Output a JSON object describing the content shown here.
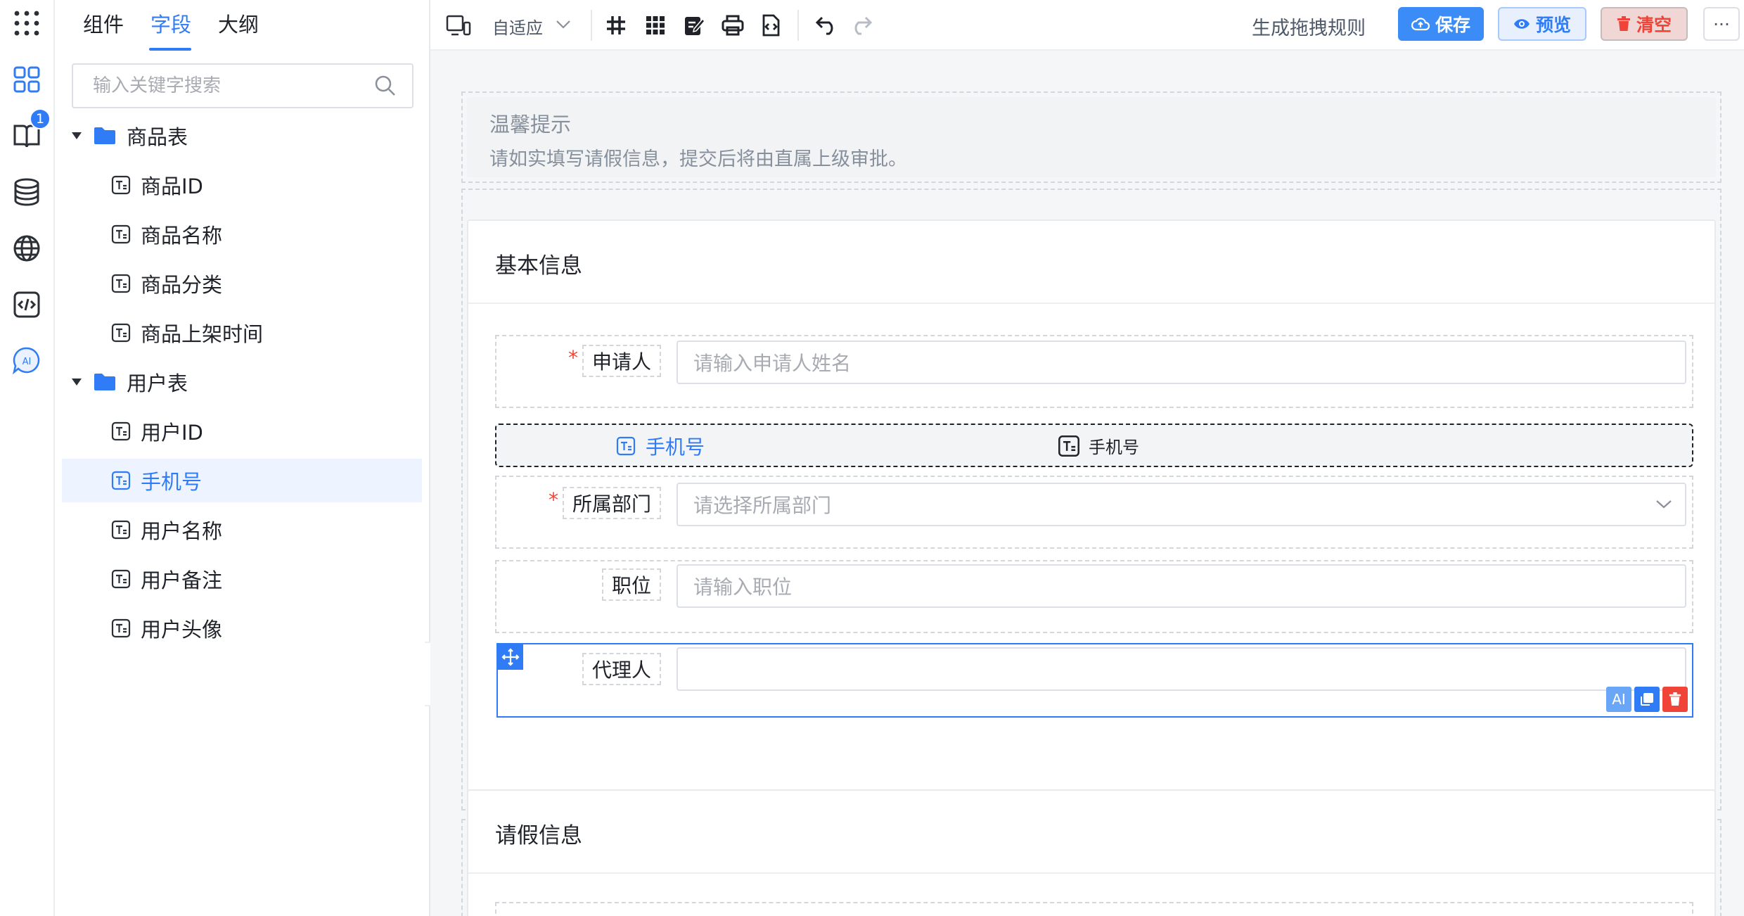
{
  "sidebar_tabs": [
    "组件",
    "字段",
    "大纲"
  ],
  "active_tab": "字段",
  "rail": {
    "badge": "1",
    "ai_label": "AI",
    "icons": [
      "component-grid-icon",
      "book-icon",
      "database-icon",
      "globe-icon",
      "code-icon",
      "ai-chat-icon"
    ]
  },
  "search": {
    "placeholder": "输入关键字搜索"
  },
  "tree": [
    {
      "name": "商品表",
      "fields": [
        "商品ID",
        "商品名称",
        "商品分类",
        "商品上架时间"
      ]
    },
    {
      "name": "用户表",
      "fields": [
        "用户ID",
        "手机号",
        "用户名称",
        "用户备注",
        "用户头像"
      ]
    }
  ],
  "selected_field": "手机号",
  "toolbar": {
    "responsive_label": "自适应",
    "rule_label": "生成拖拽规则",
    "save": "保存",
    "preview": "预览",
    "clear": "清空",
    "more": "···"
  },
  "notice": {
    "title": "温馨提示",
    "text": "请如实填写请假信息，提交后将由直属上级审批。"
  },
  "section1": {
    "title": "基本信息",
    "applicant": {
      "label": "申请人",
      "placeholder": "请输入申请人姓名",
      "required": true
    },
    "drag_ghost": {
      "label": "手机号",
      "tag": "手机号"
    },
    "department": {
      "label": "所属部门",
      "placeholder": "请选择所属部门",
      "required": true
    },
    "position": {
      "label": "职位",
      "placeholder": "请输入职位"
    },
    "agent": {
      "label": "代理人",
      "value": "",
      "tool_ai": "AI"
    }
  },
  "section2": {
    "title": "请假信息"
  },
  "colors": {
    "accent": "#2f7cf6",
    "danger": "#f04438",
    "required": "#f04438"
  }
}
